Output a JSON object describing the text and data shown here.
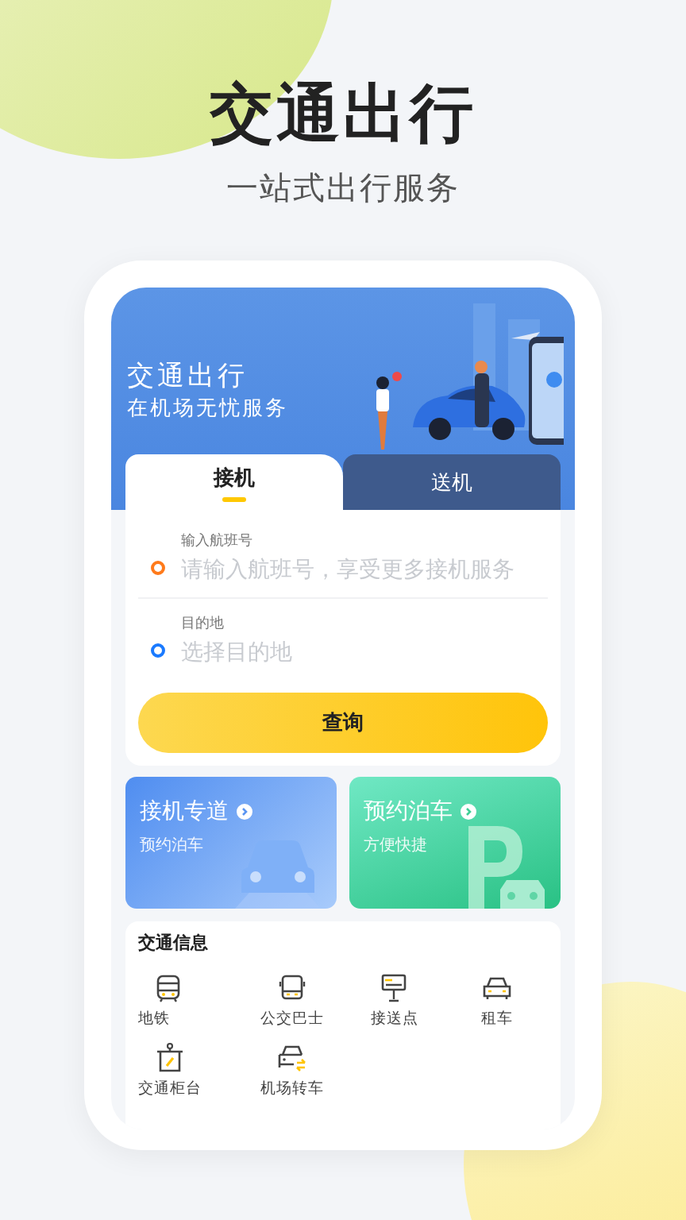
{
  "headline": "交通出行",
  "tagline": "一站式出行服务",
  "banner": {
    "title": "交通出行",
    "subtitle": "在机场无忧服务"
  },
  "tabs": [
    {
      "label": "接机",
      "selected": true
    },
    {
      "label": "送机",
      "selected": false
    }
  ],
  "fields": [
    {
      "label": "输入航班号",
      "placeholder": "请输入航班号，享受更多接机服务",
      "color": "#ff7a1a"
    },
    {
      "label": "目的地",
      "placeholder": "选择目的地",
      "color": "#1a7aff"
    }
  ],
  "search_button": "查询",
  "service_cards": [
    {
      "kind": "pickup",
      "title": "接机专道",
      "subtitle": "预约泊车"
    },
    {
      "kind": "parking",
      "title": "预约泊车",
      "subtitle": "方便快捷"
    }
  ],
  "info": {
    "title": "交通信息",
    "items": [
      {
        "kind": "metro",
        "label": "地铁"
      },
      {
        "kind": "bus",
        "label": "公交巴士"
      },
      {
        "kind": "stop",
        "label": "接送点"
      },
      {
        "kind": "taxi",
        "label": "租车"
      },
      {
        "kind": "counter",
        "label": "交通柜台"
      },
      {
        "kind": "transfer",
        "label": "机场转车"
      }
    ]
  }
}
